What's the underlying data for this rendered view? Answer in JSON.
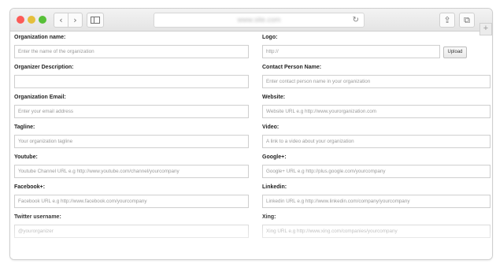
{
  "browser": {
    "nav_back_glyph": "‹",
    "nav_forward_glyph": "›",
    "reload_glyph": "↻",
    "share_glyph": "⇪",
    "tabs_glyph": "⧉",
    "new_tab_glyph": "+",
    "icons": [
      "chevron-left-icon",
      "chevron-right-icon",
      "sidebar-icon",
      "reload-icon",
      "share-icon",
      "tabs-icon",
      "plus-icon"
    ],
    "colors": {
      "close": "#fc5b57",
      "minimize": "#e5bf3c",
      "zoom": "#57c038"
    }
  },
  "form": {
    "left": [
      {
        "label": "Organization name:",
        "placeholder": "Enter the name of the organization"
      },
      {
        "label": "Organizer Description:",
        "placeholder": ""
      },
      {
        "label": "Organization Email:",
        "placeholder": "Enter your email address"
      },
      {
        "label": "Tagline:",
        "placeholder": "Your organization tagline"
      },
      {
        "label": "Youtube:",
        "placeholder": "Youtube Channel URL e.g http://www.youtube.com/channel/yourcompany"
      },
      {
        "label": "Facebook+:",
        "placeholder": "Facebook URL e.g http://www.facebook.com/yourcompany"
      },
      {
        "label": "Twitter username:",
        "placeholder": "@yourorganizer"
      }
    ],
    "right": [
      {
        "label": "Logo:",
        "placeholder": "http://",
        "button": "Upload"
      },
      {
        "label": "Contact Person Name:",
        "placeholder": "Enter contact person name in your organization"
      },
      {
        "label": "Website:",
        "placeholder": "Website URL e.g http://www.yourorganization.com"
      },
      {
        "label": "Video:",
        "placeholder": "A link to a video about your organization"
      },
      {
        "label": "Google+:",
        "placeholder": "Google+ URL e.g http://plus.google.com/yourcompany"
      },
      {
        "label": "Linkedin:",
        "placeholder": "Linkedin URL e.g http://www.linkedin.com/company/yourcompany"
      },
      {
        "label": "Xing:",
        "placeholder": "Xing URL e.g http://www.xing.com/companies/yourcompany"
      }
    ]
  }
}
